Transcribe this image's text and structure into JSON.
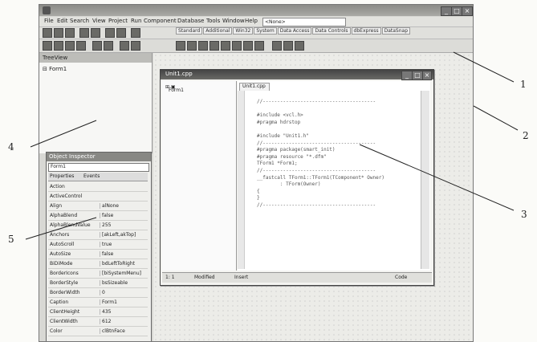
{
  "callouts": {
    "c1": "1",
    "c2": "2",
    "c3": "3",
    "c4": "4",
    "c5": "5"
  },
  "ide": {
    "menus": [
      "File",
      "Edit",
      "Search",
      "View",
      "Project",
      "Run",
      "Component",
      "Database",
      "Tools",
      "Window",
      "Help"
    ],
    "config_combo": "<None>",
    "palette_tabs": [
      "Standard",
      "Additional",
      "Win32",
      "System",
      "Data Access",
      "Data Controls",
      "dbExpress",
      "DataSnap"
    ]
  },
  "treeview": {
    "header": "TreeView",
    "root": "Form1"
  },
  "object_inspector": {
    "header": "Object Inspector",
    "combo": "Form1",
    "tabs": [
      "Properties",
      "Events"
    ],
    "properties": [
      {
        "name": "Action",
        "value": ""
      },
      {
        "name": "ActiveControl",
        "value": ""
      },
      {
        "name": "Align",
        "value": "alNone"
      },
      {
        "name": "AlphaBlend",
        "value": "false"
      },
      {
        "name": "AlphaBlendValue",
        "value": "255"
      },
      {
        "name": "Anchors",
        "value": "[akLeft,akTop]"
      },
      {
        "name": "AutoScroll",
        "value": "true"
      },
      {
        "name": "AutoSize",
        "value": "false"
      },
      {
        "name": "BiDiMode",
        "value": "bdLeftToRight"
      },
      {
        "name": "BorderIcons",
        "value": "[biSystemMenu]"
      },
      {
        "name": "BorderStyle",
        "value": "bsSizeable"
      },
      {
        "name": "BorderWidth",
        "value": "0"
      },
      {
        "name": "Caption",
        "value": "Form1"
      },
      {
        "name": "ClientHeight",
        "value": "435"
      },
      {
        "name": "ClientWidth",
        "value": "612"
      },
      {
        "name": "Color",
        "value": "clBtnFace"
      }
    ]
  },
  "unit_window": {
    "title": "Unit1.cpp",
    "left_item": "Form1",
    "editor_tab": "Unit1.cpp",
    "code_lines": [
      "//---------------------------------------",
      "",
      "#include <vcl.h>",
      "#pragma hdrstop",
      "",
      "#include \"Unit1.h\"",
      "//---------------------------------------",
      "#pragma package(smart_init)",
      "#pragma resource \"*.dfm\"",
      "TForm1 *Form1;",
      "//---------------------------------------",
      "__fastcall TForm1::TForm1(TComponent* Owner)",
      "        : TForm(Owner)",
      "{",
      "}",
      "//---------------------------------------"
    ],
    "status": {
      "pos": "1: 1",
      "mode": "Modified",
      "ins": "Insert",
      "view": "Code"
    }
  }
}
